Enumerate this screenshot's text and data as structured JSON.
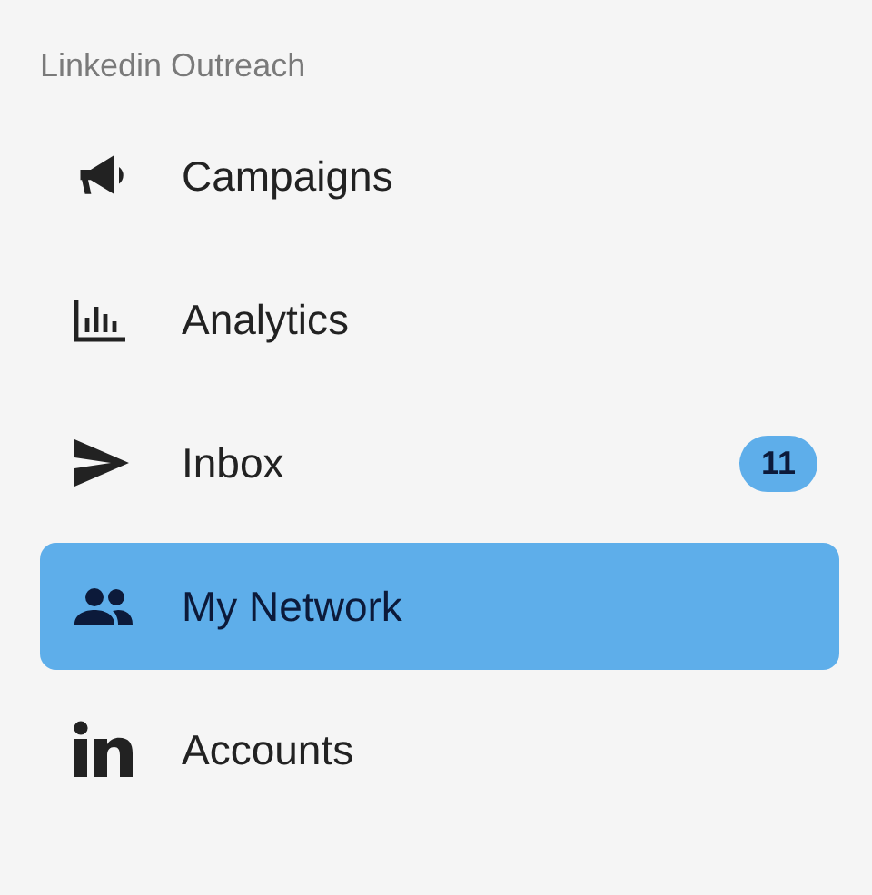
{
  "sidebar": {
    "title": "Linkedin Outreach",
    "items": [
      {
        "kind": "megaphone",
        "label": "Campaigns",
        "selected": false
      },
      {
        "kind": "chart",
        "label": "Analytics",
        "selected": false
      },
      {
        "kind": "send",
        "label": "Inbox",
        "selected": false,
        "badge": "11"
      },
      {
        "kind": "people",
        "label": "My Network",
        "selected": true
      },
      {
        "kind": "linkedin",
        "label": "Accounts",
        "selected": false
      }
    ]
  }
}
